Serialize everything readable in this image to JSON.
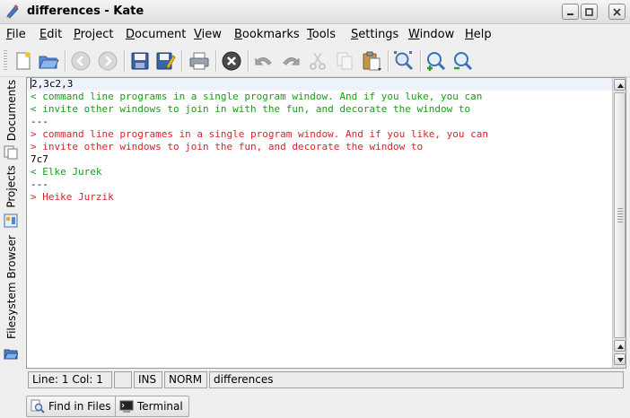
{
  "window": {
    "title": "differences - Kate",
    "controls": [
      "minimize",
      "maximize",
      "close"
    ]
  },
  "menubar": {
    "items": [
      {
        "first": "F",
        "rest": "ile"
      },
      {
        "first": "E",
        "rest": "dit"
      },
      {
        "first": "P",
        "rest": "roject"
      },
      {
        "first": "D",
        "rest": "ocument"
      },
      {
        "first": "V",
        "rest": "iew"
      },
      {
        "first": "B",
        "rest": "ookmarks"
      },
      {
        "first": "T",
        "rest": "ools"
      },
      {
        "first": "S",
        "rest": "ettings"
      },
      {
        "first": "W",
        "rest": "indow"
      },
      {
        "first": "H",
        "rest": "elp"
      }
    ]
  },
  "toolbar": {
    "icons": [
      "new-document-icon",
      "open-document-icon",
      "back-icon",
      "forward-icon",
      "save-icon",
      "save-as-icon",
      "print-icon",
      "close-document-icon",
      "undo-icon",
      "redo-icon",
      "cut-icon",
      "copy-icon",
      "paste-icon",
      "find-icon",
      "zoom-in-icon",
      "zoom-out-icon"
    ]
  },
  "sidebar": {
    "tabs": [
      {
        "label": "Documents",
        "icon": "documents-icon"
      },
      {
        "label": "Projects",
        "icon": "projects-icon"
      },
      {
        "label": "Filesystem Browser",
        "icon": "folder-icon"
      }
    ]
  },
  "editor": {
    "lines": [
      {
        "text": "2,3c2,3",
        "color": "plain"
      },
      {
        "text": "< command line programs in a single program window. And if you luke, you can",
        "color": "green"
      },
      {
        "text": "< invite other windows to join in with the fun, and decorate the window to",
        "color": "green"
      },
      {
        "text": "---",
        "color": "plain"
      },
      {
        "text": "> command line programes in a single program window. And if you like, you can",
        "color": "red"
      },
      {
        "text": "> invite other windows to join the fun, and decorate the window to",
        "color": "red"
      },
      {
        "text": "7c7",
        "color": "plain"
      },
      {
        "text": "< Elke Jurek",
        "color": "green"
      },
      {
        "text": "---",
        "color": "plain"
      },
      {
        "text": "> Heike Jurzik",
        "color": "red"
      }
    ]
  },
  "statusbar": {
    "position": "Line: 1 Col: 1",
    "modified": "",
    "insert_mode": "INS",
    "selection_mode": "NORM",
    "document_name": "differences"
  },
  "bottom_tabs": {
    "find_in_files": "Find in Files",
    "terminal": "Terminal"
  },
  "colors": {
    "removed_line": "#1a9b1a",
    "added_line": "#d8232a",
    "current_line": "#eef2fb"
  }
}
